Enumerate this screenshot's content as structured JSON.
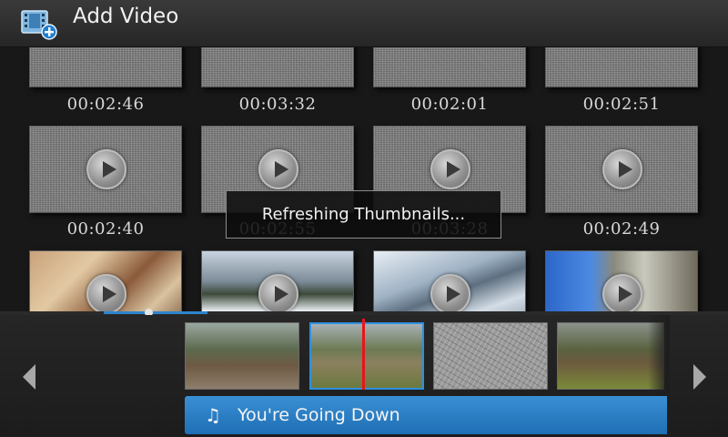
{
  "header": {
    "title": "Add Video",
    "icon": "film-add-icon"
  },
  "grid": {
    "rows": [
      {
        "durations": [
          "00:02:46",
          "00:03:32",
          "00:02:01",
          "00:02:51"
        ]
      },
      {
        "durations": [
          "00:02:40",
          "00:02:55",
          "00:03:28",
          "00:02:49"
        ]
      },
      {
        "durations": [
          "",
          "",
          "",
          ""
        ]
      }
    ]
  },
  "toast": {
    "message": "Refreshing Thumbnails..."
  },
  "timeline": {
    "clips": [
      "forest-trail",
      "forest-trail-selected",
      "embossed-texture",
      "forest-clearing"
    ],
    "selected_index": 1
  },
  "music": {
    "title": "You're Going Down",
    "icon": "music-note-icon"
  },
  "colors": {
    "accent": "#2e85cc",
    "playhead": "#e8141a",
    "music_bar": "#2a7fc4"
  }
}
